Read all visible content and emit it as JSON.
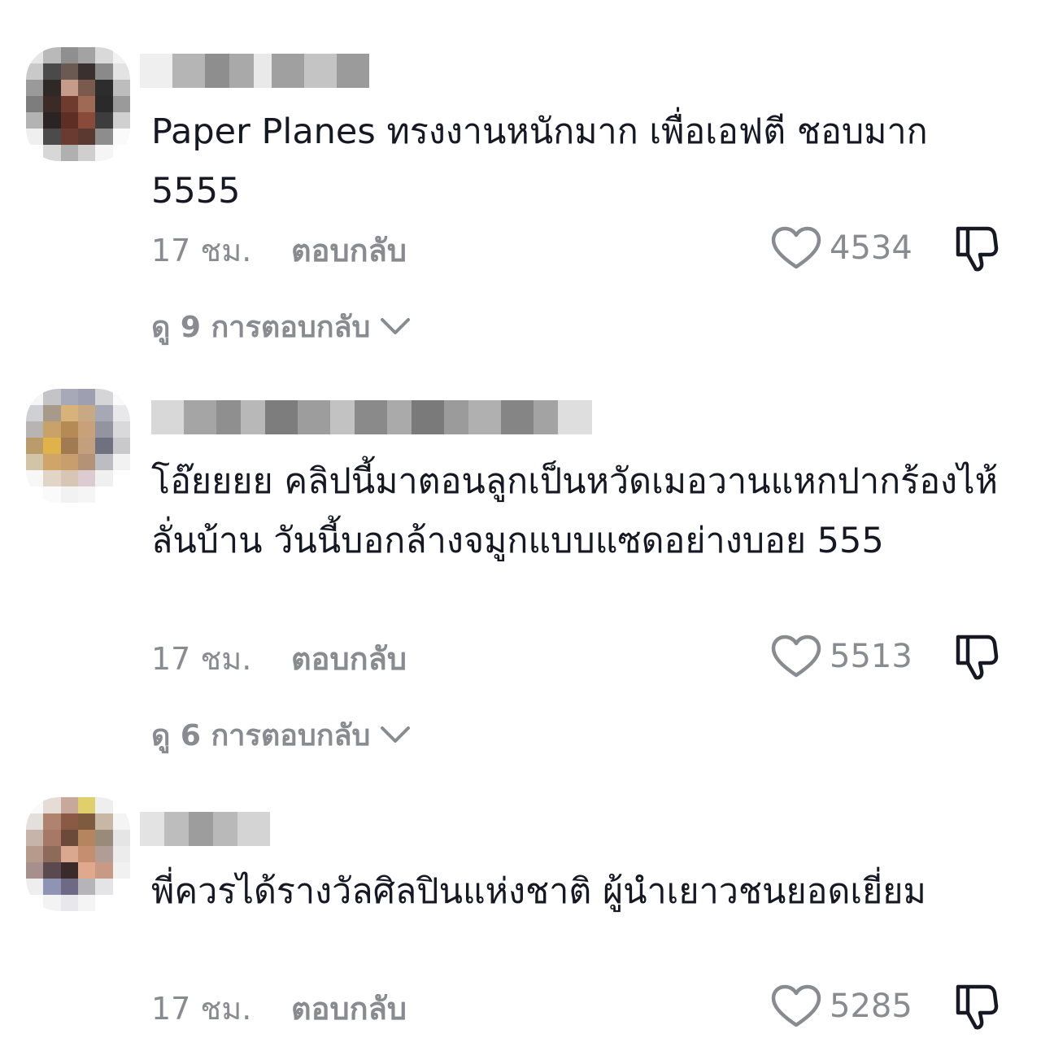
{
  "comments": [
    {
      "text": "Paper Planes ทรงงานหนักมาก เพื่อเอฟตี ชอบมาก 5555",
      "time": "17 ชม.",
      "reply_label": "ตอบกลับ",
      "likes": "4534",
      "view_replies": "ดู 9 การตอบกลับ",
      "username_blurred": true
    },
    {
      "text": "โอ๊ยยยย คลิปนี้มาตอนลูกเป็นหวัดเมอวานแหกปากร้องไห้ลั่นบ้าน วันนี้บอกล้างจมูกแบบแซดอย่างบอย 555",
      "time": "17 ชม.",
      "reply_label": "ตอบกลับ",
      "likes": "5513",
      "view_replies": "ดู 6 การตอบกลับ",
      "username_blurred": true
    },
    {
      "text": "พี่ควรได้รางวัลศิลปินแห่งชาติ ผู้นำเยาวชนยอดเยี่ยม",
      "time": "17 ชม.",
      "reply_label": "ตอบกลับ",
      "likes": "5285",
      "username_blurred": true
    }
  ],
  "icons": {
    "like": "heart-outline-icon",
    "dislike": "thumbs-down-icon",
    "expand": "chevron-down-icon"
  },
  "colors": {
    "text": "#161823",
    "secondary": "#8a8b91",
    "background": "#ffffff"
  }
}
